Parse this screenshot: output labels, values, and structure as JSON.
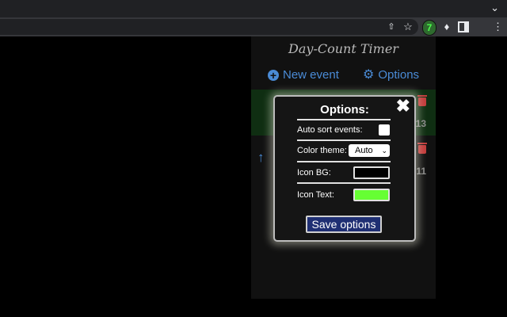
{
  "browser": {
    "extension_badge": "7"
  },
  "popup": {
    "app_title": "Day-Count Timer",
    "new_event_label": "New event",
    "options_label": "Options",
    "events": [
      {
        "number": "13"
      },
      {
        "number": "11"
      }
    ]
  },
  "options_modal": {
    "title": "Options:",
    "auto_sort_label": "Auto sort events:",
    "auto_sort_checked": false,
    "color_theme_label": "Color theme:",
    "color_theme_value": "Auto",
    "icon_bg_label": "Icon BG:",
    "icon_bg_color": "#000000",
    "icon_text_label": "Icon Text:",
    "icon_text_color": "#66ff33",
    "save_label": "Save options"
  }
}
